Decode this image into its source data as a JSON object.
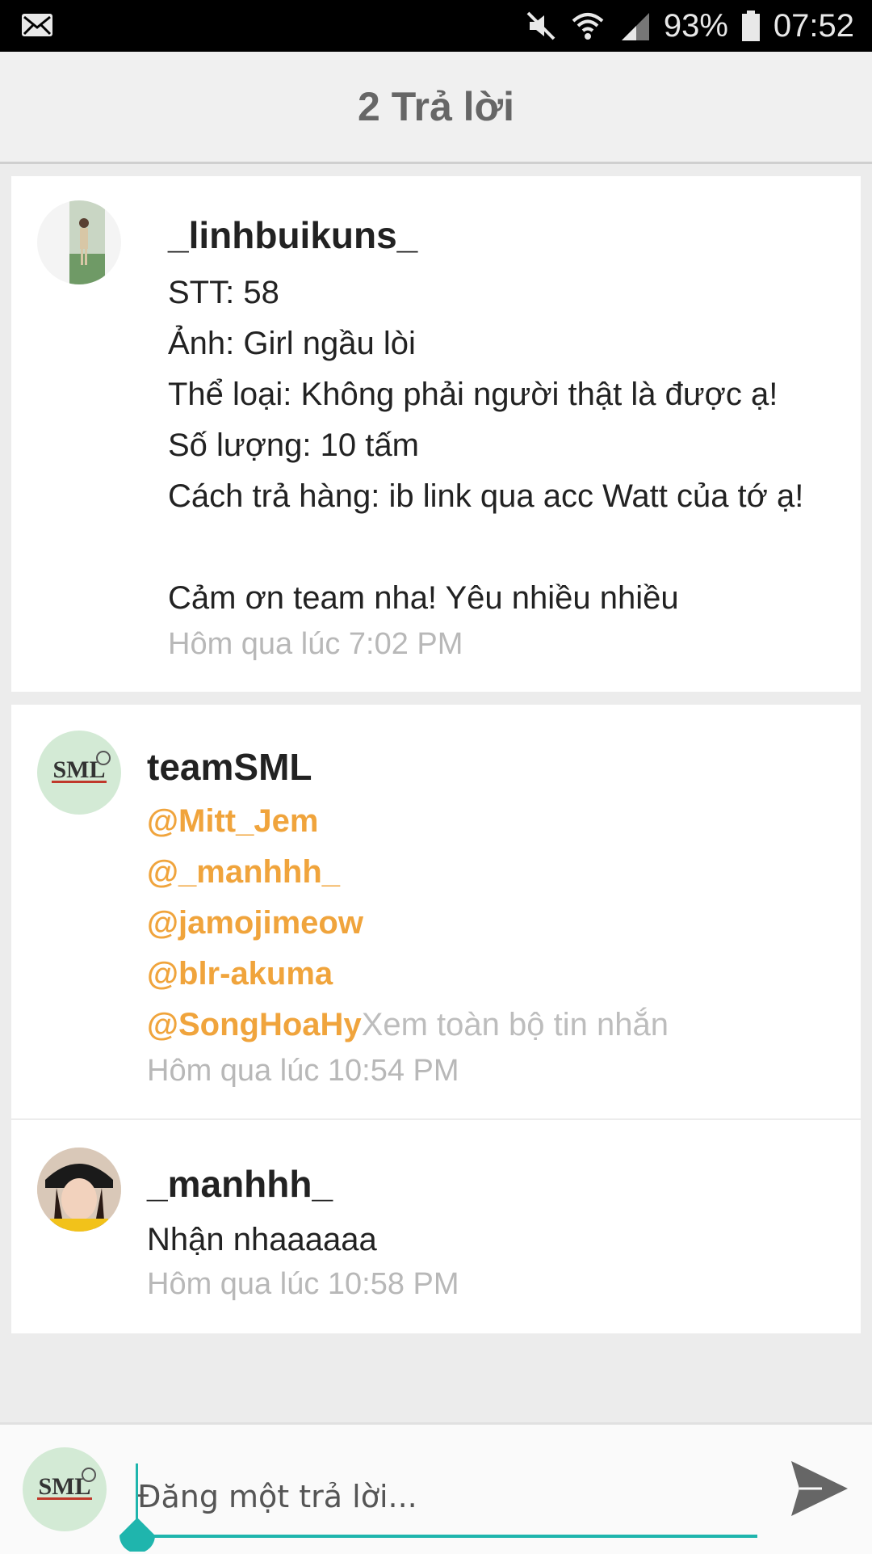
{
  "status_bar": {
    "battery": "93%",
    "time": "07:52",
    "icons": [
      "mail-icon",
      "mute-icon",
      "wifi-icon",
      "signal-icon",
      "battery-icon"
    ]
  },
  "header": {
    "title": "2 Trả lời"
  },
  "original_post": {
    "username": "_linhbuikuns_",
    "lines": [
      "STT: 58",
      "Ảnh: Girl ngầu lòi",
      "Thể loại: Không phải người thật là được ạ!",
      "Số lượng: 10 tấm",
      "Cách trả hàng: ib link qua acc Watt của tớ ạ!",
      "",
      "Cảm ơn team nha! Yêu nhiều nhiều"
    ],
    "timestamp": "Hôm qua lúc 7:02 PM"
  },
  "replies": [
    {
      "username": "teamSML",
      "mentions": [
        "@Mitt_Jem",
        "@_manhhh_",
        "@jamojimeow",
        "@blr-akuma",
        "@SongHoaHy"
      ],
      "see_all": "Xem toàn bộ tin nhắn",
      "timestamp": "Hôm qua lúc 10:54 PM"
    },
    {
      "username": "_manhhh_",
      "text": "Nhận nhaaaaaa",
      "timestamp": "Hôm qua lúc 10:58 PM"
    }
  ],
  "reply_bar": {
    "placeholder": "Đăng một trả lời...",
    "value": ""
  },
  "avatar_logo_text": "SML",
  "colors": {
    "mention": "#f0a43c",
    "accent": "#1fb5ad",
    "timestamp": "#b8b8b8"
  }
}
